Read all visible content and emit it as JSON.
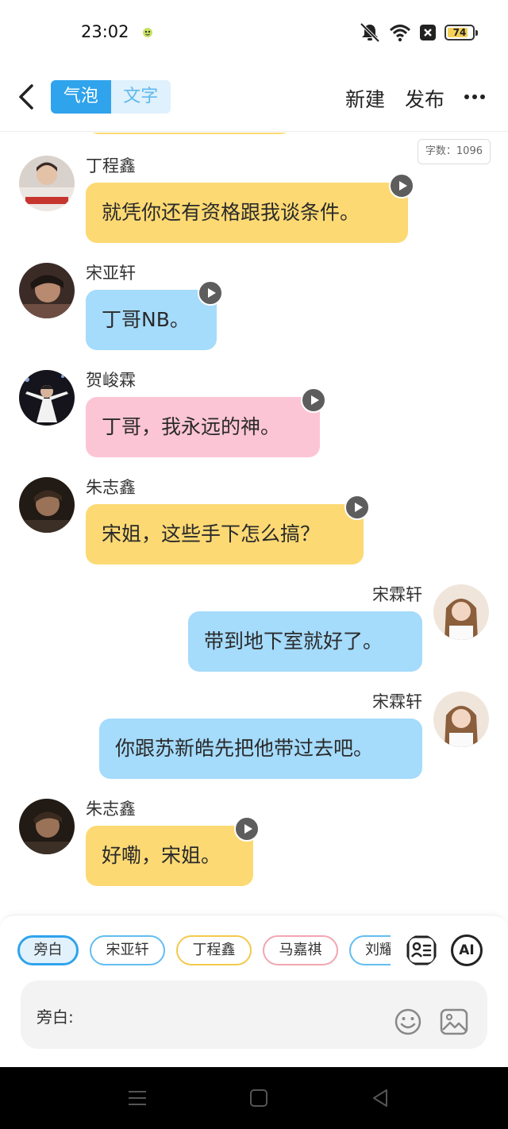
{
  "status_bar": {
    "time": "23:02",
    "battery": "74",
    "battery_level": 0.74,
    "icons": [
      "mute-bell-icon",
      "wifi-icon",
      "sim-off-icon",
      "battery-icon"
    ]
  },
  "top_bar": {
    "tabs": [
      {
        "label": "气泡",
        "active": true
      },
      {
        "label": "文字",
        "active": false
      }
    ],
    "new_label": "新建",
    "publish_label": "发布"
  },
  "chat": {
    "word_count": "字数：1096",
    "messages": [
      {
        "side": "left",
        "name": "丁程鑫",
        "text": "就凭你还有资格跟我谈条件。",
        "color": "yellow",
        "has_audio": true
      },
      {
        "side": "left",
        "name": "宋亚轩",
        "text": "丁哥NB。",
        "color": "blue",
        "has_audio": true
      },
      {
        "side": "left",
        "name": "贺峻霖",
        "text": "丁哥，我永远的神。",
        "color": "pink",
        "has_audio": true
      },
      {
        "side": "left",
        "name": "朱志鑫",
        "text": "宋姐，这些手下怎么搞？",
        "color": "yellow",
        "has_audio": true
      },
      {
        "side": "right",
        "name": "宋霖轩",
        "text": "带到地下室就好了。",
        "color": "blue",
        "has_audio": false
      },
      {
        "side": "right",
        "name": "宋霖轩",
        "text": "你跟苏新皓先把他带过去吧。",
        "color": "blue",
        "has_audio": false
      },
      {
        "side": "left",
        "name": "朱志鑫",
        "text": "好嘞，宋姐。",
        "color": "yellow",
        "has_audio": true
      }
    ]
  },
  "bottom": {
    "roles": [
      "旁白",
      "宋亚轩",
      "丁程鑫",
      "马嘉祺",
      "刘耀"
    ],
    "selected_role": "旁白",
    "ai_label": "AI",
    "input_label": "旁白:"
  },
  "colors": {
    "accent": "#2fa3ec",
    "bubble_yellow": "#fcd973",
    "bubble_blue": "#a5dbfb",
    "bubble_pink": "#fcc5d6"
  }
}
